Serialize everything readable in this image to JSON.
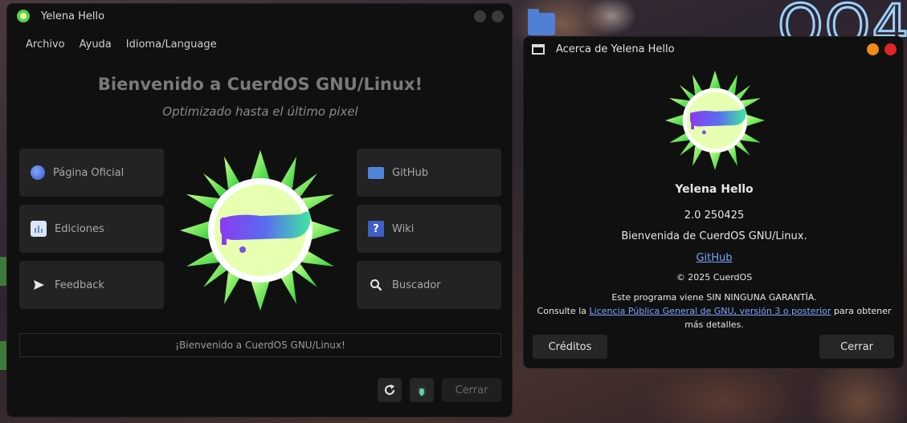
{
  "main_window": {
    "title": "Yelena Hello",
    "menu": [
      "Archivo",
      "Ayuda",
      "Idioma/Language"
    ],
    "welcome_title": "Bienvenido a CuerdOS GNU/Linux!",
    "welcome_subtitle": "Optimizado hasta el último pixel",
    "left_cards": [
      {
        "label": "Página Oficial",
        "icon": "globe-icon"
      },
      {
        "label": "Ediciones",
        "icon": "editions-icon"
      },
      {
        "label": "Feedback",
        "icon": "send-icon"
      }
    ],
    "right_cards": [
      {
        "label": "GitHub",
        "icon": "folder-icon"
      },
      {
        "label": "Wiki",
        "icon": "help-icon"
      },
      {
        "label": "Buscador",
        "icon": "search-icon"
      }
    ],
    "status_text": "¡Bienvenido a CuerdOS GNU/Linux!",
    "close_label": "Cerrar"
  },
  "about_window": {
    "title": "Acerca de Yelena Hello",
    "app_name": "Yelena Hello",
    "version": "2.0 250425",
    "comment": "Bienvenida de CuerdOS GNU/Linux.",
    "website_label": "GitHub",
    "copyright": "© 2025 CuerdOS",
    "license_line1": "Este programa viene SIN NINGUNA GARANTÍA.",
    "license_pre": "Consulte la ",
    "license_link": "Licencia Pública General de GNU, versión 3 o posterior",
    "license_post": " para obtener más detalles.",
    "credits_label": "Créditos",
    "close_label": "Cerrar"
  },
  "colors": {
    "window_bg": "#101010",
    "card_bg": "#232323",
    "link": "#7aa7ff",
    "close_orange": "#f08a12",
    "close_red": "#e02424",
    "logo_green": "#4fd34a",
    "logo_light": "#e8ff9c"
  }
}
